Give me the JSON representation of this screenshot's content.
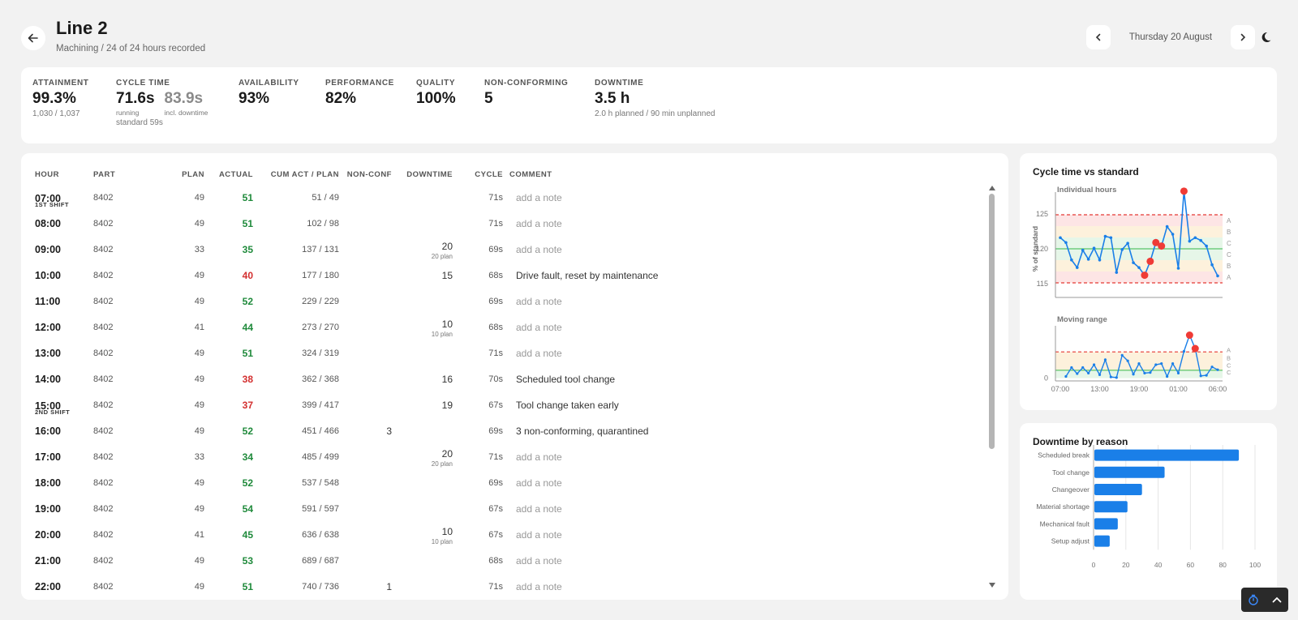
{
  "header": {
    "title": "Line 2",
    "subtitle": "Machining / 24 of 24 hours recorded",
    "date": "Thursday 20 August"
  },
  "kpis": {
    "attainment": {
      "label": "ATTAINMENT",
      "value": "99.3%",
      "sub": "1,030 / 1,037"
    },
    "cycle_time": {
      "label": "CYCLE TIME",
      "running_value": "71.6s",
      "running_label": "running",
      "incl_value": "83.9s",
      "incl_label": "incl. downtime",
      "standard": "standard 59s"
    },
    "availability": {
      "label": "AVAILABILITY",
      "value": "93%"
    },
    "performance": {
      "label": "PERFORMANCE",
      "value": "82%"
    },
    "quality": {
      "label": "QUALITY",
      "value": "100%"
    },
    "nonconforming": {
      "label": "NON-CONFORMING",
      "value": "5"
    },
    "downtime": {
      "label": "DOWNTIME",
      "value": "3.5 h",
      "sub": "2.0 h planned / 90 min unplanned"
    }
  },
  "table": {
    "headers": {
      "hour": "HOUR",
      "part": "PART",
      "plan": "PLAN",
      "actual": "ACTUAL",
      "cum": "CUM ACT / PLAN",
      "nonconf": "NON-CONF",
      "downtime": "DOWNTIME",
      "cycle": "CYCLE",
      "comment": "COMMENT"
    },
    "rows": [
      {
        "hour": "07:00",
        "shift": "1ST SHIFT",
        "part": "8402",
        "plan": "49",
        "actual": "51",
        "status": "green",
        "cum": "51 / 49",
        "nonconf": "",
        "downtime": "",
        "downtime_plan": "",
        "cycle": "71s",
        "comment": "add a note",
        "is_note": true
      },
      {
        "hour": "08:00",
        "shift": "",
        "part": "8402",
        "plan": "49",
        "actual": "51",
        "status": "green",
        "cum": "102 / 98",
        "nonconf": "",
        "downtime": "",
        "downtime_plan": "",
        "cycle": "71s",
        "comment": "add a note",
        "is_note": true
      },
      {
        "hour": "09:00",
        "shift": "",
        "part": "8402",
        "plan": "33",
        "actual": "35",
        "status": "green",
        "cum": "137 / 131",
        "nonconf": "",
        "downtime": "20",
        "downtime_plan": "20 plan",
        "cycle": "69s",
        "comment": "add a note",
        "is_note": true
      },
      {
        "hour": "10:00",
        "shift": "",
        "part": "8402",
        "plan": "49",
        "actual": "40",
        "status": "red",
        "cum": "177 / 180",
        "nonconf": "",
        "downtime": "15",
        "downtime_plan": "",
        "cycle": "68s",
        "comment": "Drive fault, reset by maintenance",
        "is_note": false
      },
      {
        "hour": "11:00",
        "shift": "",
        "part": "8402",
        "plan": "49",
        "actual": "52",
        "status": "green",
        "cum": "229 / 229",
        "nonconf": "",
        "downtime": "",
        "downtime_plan": "",
        "cycle": "69s",
        "comment": "add a note",
        "is_note": true
      },
      {
        "hour": "12:00",
        "shift": "",
        "part": "8402",
        "plan": "41",
        "actual": "44",
        "status": "green",
        "cum": "273 / 270",
        "nonconf": "",
        "downtime": "10",
        "downtime_plan": "10 plan",
        "cycle": "68s",
        "comment": "add a note",
        "is_note": true
      },
      {
        "hour": "13:00",
        "shift": "",
        "part": "8402",
        "plan": "49",
        "actual": "51",
        "status": "green",
        "cum": "324 / 319",
        "nonconf": "",
        "downtime": "",
        "downtime_plan": "",
        "cycle": "71s",
        "comment": "add a note",
        "is_note": true
      },
      {
        "hour": "14:00",
        "shift": "",
        "part": "8402",
        "plan": "49",
        "actual": "38",
        "status": "red",
        "cum": "362 / 368",
        "nonconf": "",
        "downtime": "16",
        "downtime_plan": "",
        "cycle": "70s",
        "comment": "Scheduled tool change",
        "is_note": false
      },
      {
        "hour": "15:00",
        "shift": "2ND SHIFT",
        "part": "8402",
        "plan": "49",
        "actual": "37",
        "status": "red",
        "cum": "399 / 417",
        "nonconf": "",
        "downtime": "19",
        "downtime_plan": "",
        "cycle": "67s",
        "comment": "Tool change taken early",
        "is_note": false
      },
      {
        "hour": "16:00",
        "shift": "",
        "part": "8402",
        "plan": "49",
        "actual": "52",
        "status": "green",
        "cum": "451 / 466",
        "nonconf": "3",
        "downtime": "",
        "downtime_plan": "",
        "cycle": "69s",
        "comment": "3 non-conforming, quarantined",
        "is_note": false
      },
      {
        "hour": "17:00",
        "shift": "",
        "part": "8402",
        "plan": "33",
        "actual": "34",
        "status": "green",
        "cum": "485 / 499",
        "nonconf": "",
        "downtime": "20",
        "downtime_plan": "20 plan",
        "cycle": "71s",
        "comment": "add a note",
        "is_note": true
      },
      {
        "hour": "18:00",
        "shift": "",
        "part": "8402",
        "plan": "49",
        "actual": "52",
        "status": "green",
        "cum": "537 / 548",
        "nonconf": "",
        "downtime": "",
        "downtime_plan": "",
        "cycle": "69s",
        "comment": "add a note",
        "is_note": true
      },
      {
        "hour": "19:00",
        "shift": "",
        "part": "8402",
        "plan": "49",
        "actual": "54",
        "status": "green",
        "cum": "591 / 597",
        "nonconf": "",
        "downtime": "",
        "downtime_plan": "",
        "cycle": "67s",
        "comment": "add a note",
        "is_note": true
      },
      {
        "hour": "20:00",
        "shift": "",
        "part": "8402",
        "plan": "41",
        "actual": "45",
        "status": "green",
        "cum": "636 / 638",
        "nonconf": "",
        "downtime": "10",
        "downtime_plan": "10 plan",
        "cycle": "67s",
        "comment": "add a note",
        "is_note": true
      },
      {
        "hour": "21:00",
        "shift": "",
        "part": "8402",
        "plan": "49",
        "actual": "53",
        "status": "green",
        "cum": "689 / 687",
        "nonconf": "",
        "downtime": "",
        "downtime_plan": "",
        "cycle": "68s",
        "comment": "add a note",
        "is_note": true
      },
      {
        "hour": "22:00",
        "shift": "",
        "part": "8402",
        "plan": "49",
        "actual": "51",
        "status": "green",
        "cum": "740 / 736",
        "nonconf": "1",
        "downtime": "",
        "downtime_plan": "",
        "cycle": "71s",
        "comment": "add a note",
        "is_note": true
      }
    ]
  },
  "colors": {
    "green": "#1f8a3b",
    "red": "#d32f2f",
    "accent": "#1a7fe8",
    "violation": "#ef3b36"
  },
  "icons": {
    "back": "arrow-left-icon",
    "prev": "chevron-left-icon",
    "next": "chevron-right-icon",
    "theme": "moon-icon",
    "timer": "stopwatch-icon",
    "collapse": "chevron-up-icon"
  },
  "chart_data": [
    {
      "type": "line",
      "title": "Cycle time vs standard",
      "subtitle": "Individual hours",
      "ylabel": "% of standard",
      "ylim": [
        113,
        127
      ],
      "yticks": [
        115,
        120,
        125
      ],
      "zone_labels": [
        "A",
        "B",
        "C",
        "C",
        "B",
        "A"
      ],
      "control_limits": {
        "upper": 124.9,
        "center": 120,
        "lower": 115.1
      },
      "values": [
        121.6,
        120.9,
        118.4,
        117.3,
        119.8,
        118.5,
        120.1,
        118.4,
        121.8,
        121.6,
        116.6,
        119.9,
        120.8,
        118.0,
        117.3,
        116.2,
        118.2,
        120.9,
        120.4,
        123.2,
        122.1,
        117.2,
        128.3,
        121.1,
        121.6,
        121.2,
        120.4,
        117.7,
        116.1
      ],
      "violations": [
        15,
        16,
        17,
        18,
        22
      ],
      "series": [
        {
          "name": "Individual hours"
        }
      ]
    },
    {
      "type": "line",
      "title": "",
      "subtitle": "Moving range",
      "ylim": [
        -0.5,
        8.5
      ],
      "yticks": [
        0
      ],
      "xticks": [
        "07:00",
        "13:00",
        "19:00",
        "01:00",
        "06:00"
      ],
      "zone_labels": [
        "A",
        "B",
        "C",
        "C"
      ],
      "control_limits": {
        "upper": 4.7,
        "center": 1.4
      },
      "values": [
        0.3,
        1.9,
        0.8,
        1.9,
        0.9,
        2.4,
        0.6,
        3.3,
        0.2,
        0.1,
        4.1,
        3.1,
        0.7,
        2.6,
        0.9,
        1.0,
        2.4,
        2.6,
        0.3,
        2.6,
        0.9,
        4.8,
        7.7,
        5.3,
        0.4,
        0.5,
        2.0,
        1.5
      ],
      "violations": [
        22,
        23
      ]
    },
    {
      "type": "bar",
      "orientation": "horizontal",
      "title": "Downtime by reason",
      "categories": [
        "Scheduled break",
        "Tool change",
        "Changeover",
        "Material shortage",
        "Mechanical fault",
        "Setup adjust"
      ],
      "values": [
        90,
        44,
        30,
        21,
        15,
        10
      ],
      "xlim": [
        0,
        100
      ],
      "xticks": [
        0,
        20,
        40,
        60,
        80,
        100
      ]
    }
  ]
}
